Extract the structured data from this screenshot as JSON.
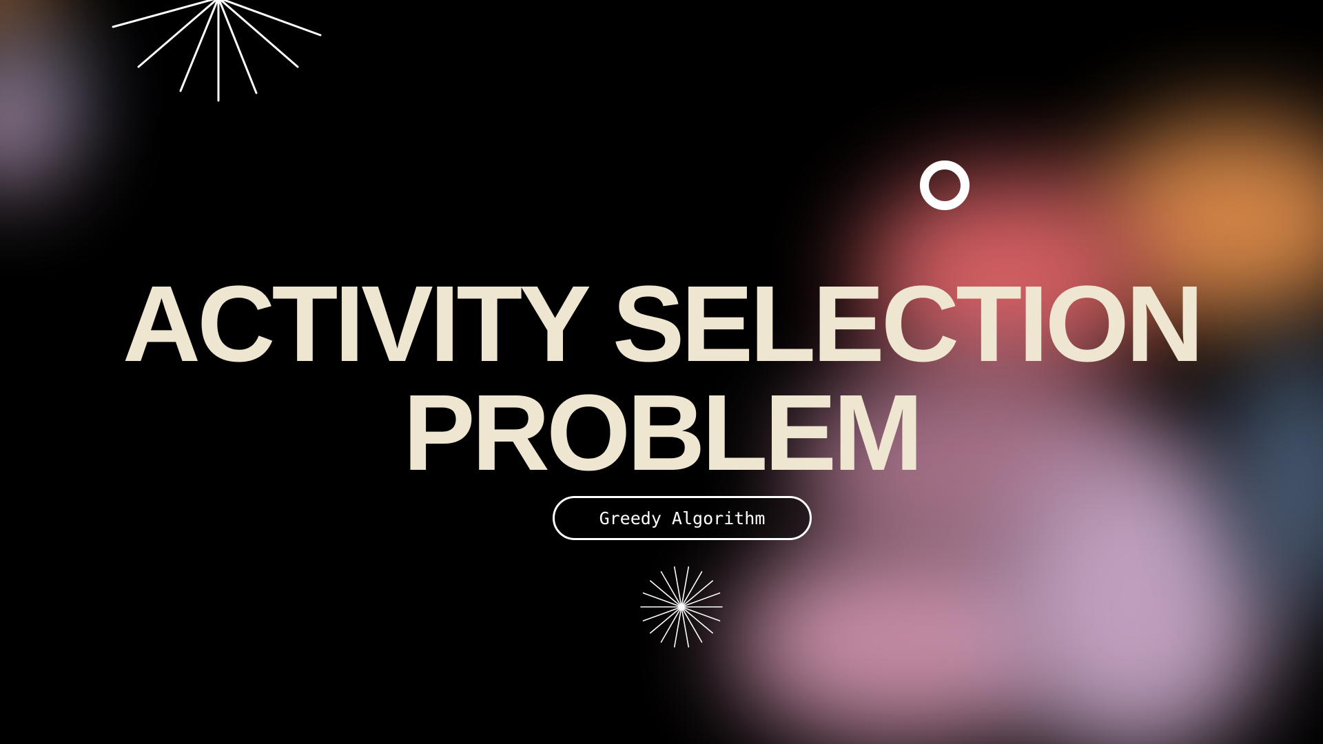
{
  "slide": {
    "title_line1": "ACTIVITY SELECTION",
    "title_line2": "PROBLEM",
    "subtitle_pill": "Greedy Algorithm"
  },
  "decorations": {
    "top_burst": "starburst-icon",
    "bottom_burst": "starburst-icon",
    "ring": "ring-icon"
  },
  "colors": {
    "background": "#000000",
    "title": "#efe6d2",
    "pill_border": "#ffffff",
    "gradient_orange": "#e8934e",
    "gradient_coral": "#de6468",
    "gradient_pink": "#d89ab6",
    "gradient_lavender": "#c7a6c6",
    "gradient_blue": "#4b5e78"
  }
}
